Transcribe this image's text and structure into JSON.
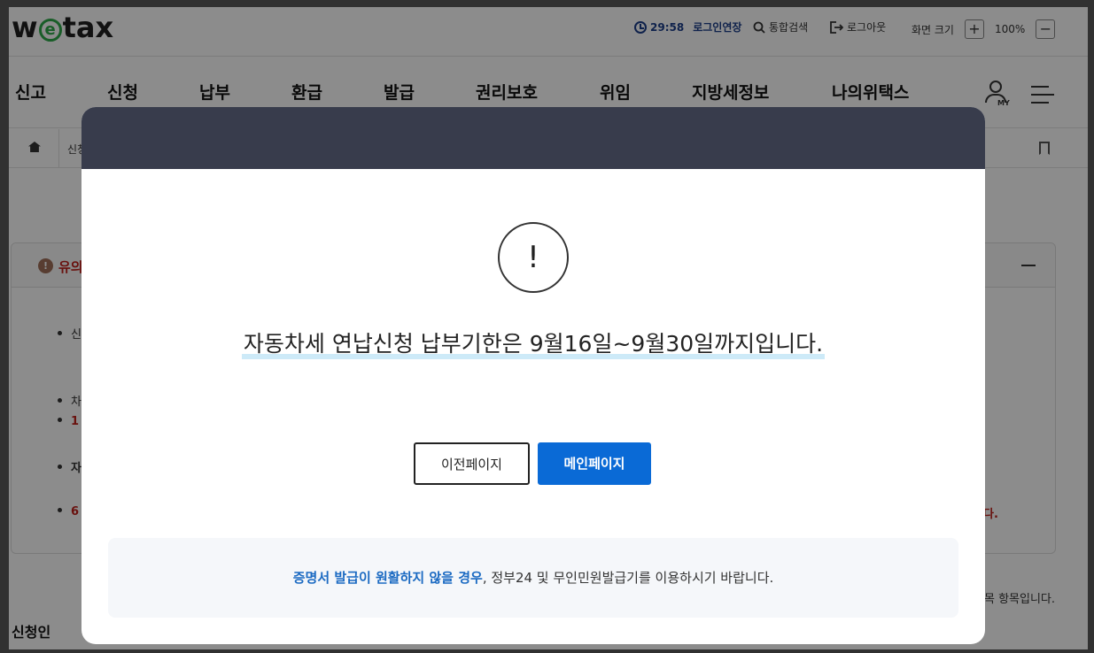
{
  "header": {
    "logo": {
      "pre": "w",
      "mid": "e",
      "post": "tax"
    },
    "timer": "29:58",
    "extend_login": "로그인연장",
    "search": "통합검색",
    "logout": "로그아웃",
    "screen_size": "화면 크기",
    "zoom_in": "+",
    "zoom_level": "100%",
    "zoom_out": "−"
  },
  "nav": {
    "items": [
      "신고",
      "신청",
      "납부",
      "환급",
      "발급",
      "권리보호",
      "위임",
      "지방세정보",
      "나의위택스"
    ],
    "my_label": "MY"
  },
  "breadcrumb": {
    "first": "신청"
  },
  "notice": {
    "title": "유의",
    "bullets": [
      "신",
      "차",
      "1",
      "자",
      "6"
    ],
    "tail_text": "다.",
    "required_note": "목 항목입니다.",
    "applicant_label": "신청인"
  },
  "modal": {
    "message": "자동차세 연납신청 납부기한은 9월16일~9월30일까지입니다.",
    "prev_button": "이전페이지",
    "main_button": "메인페이지",
    "info_highlight": "증명서 발급이 원활하지 않을 경우",
    "info_rest": ", 정부24 및 무인민원발급기를 이용하시기 바랍니다."
  },
  "colors": {
    "modal_header": "#383c4c",
    "primary_button": "#0a6ad6",
    "highlight_text": "#1b6ac2",
    "warning_red": "#c0201a"
  }
}
